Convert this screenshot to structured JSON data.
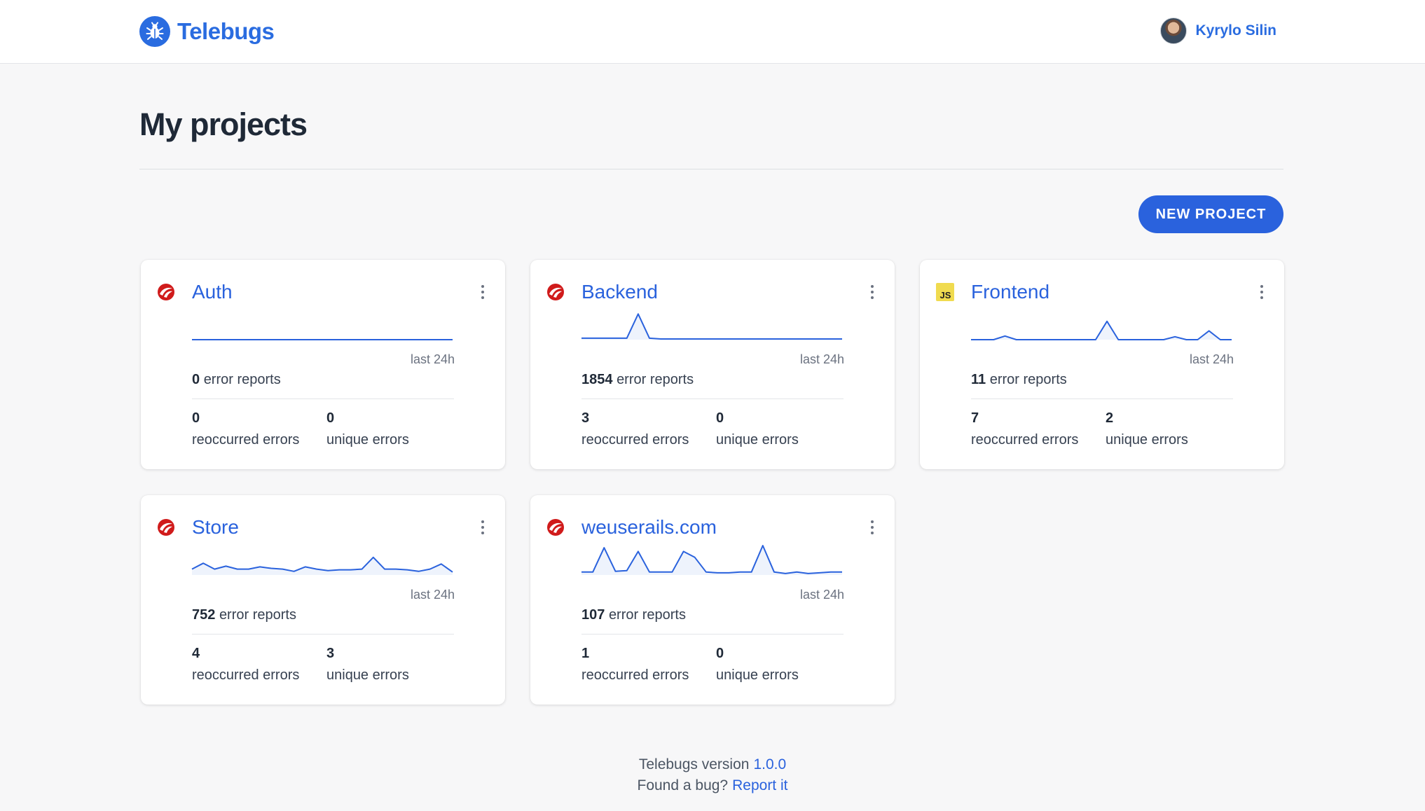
{
  "header": {
    "brand": "Telebugs",
    "user_name": "Kyrylo Silin"
  },
  "page": {
    "title": "My projects",
    "new_project_label": "NEW PROJECT"
  },
  "colors": {
    "accent": "#2a62dd",
    "ruby": "#d01b1b",
    "javascript": "#f0db4f"
  },
  "projects": [
    {
      "name": "Auth",
      "icon": "ruby-icon",
      "period": "last 24h",
      "error_reports": "0",
      "error_reports_label": "error reports",
      "reoccurred": "0",
      "reoccurred_label": "reoccurred errors",
      "unique": "0",
      "unique_label": "unique errors",
      "sparkline": [
        0,
        0,
        0,
        0,
        0,
        0,
        0,
        0,
        0,
        0,
        0,
        0,
        0,
        0,
        0,
        0,
        0,
        0,
        0,
        0,
        0,
        0,
        0,
        0
      ]
    },
    {
      "name": "Backend",
      "icon": "ruby-icon",
      "period": "last 24h",
      "error_reports": "1854",
      "error_reports_label": "error reports",
      "reoccurred": "3",
      "reoccurred_label": "reoccurred errors",
      "unique": "0",
      "unique_label": "unique errors",
      "sparkline": [
        2,
        2,
        2,
        2,
        2,
        35,
        2,
        1,
        1,
        1,
        1,
        1,
        1,
        1,
        1,
        1,
        1,
        1,
        1,
        1,
        1,
        1,
        1,
        1
      ]
    },
    {
      "name": "Frontend",
      "icon": "js-icon",
      "period": "last 24h",
      "error_reports": "11",
      "error_reports_label": "error reports",
      "reoccurred": "7",
      "reoccurred_label": "reoccurred errors",
      "unique": "2",
      "unique_label": "unique errors",
      "sparkline": [
        0,
        0,
        0,
        5,
        0,
        0,
        0,
        0,
        0,
        0,
        0,
        0,
        25,
        0,
        0,
        0,
        0,
        0,
        4,
        0,
        0,
        12,
        0,
        0
      ]
    },
    {
      "name": "Store",
      "icon": "ruby-icon",
      "period": "last 24h",
      "error_reports": "752",
      "error_reports_label": "error reports",
      "reoccurred": "4",
      "reoccurred_label": "reoccurred errors",
      "unique": "3",
      "unique_label": "unique errors",
      "sparkline": [
        8,
        16,
        8,
        12,
        8,
        8,
        11,
        9,
        8,
        5,
        11,
        8,
        6,
        7,
        7,
        8,
        24,
        8,
        8,
        7,
        5,
        8,
        15,
        4
      ]
    },
    {
      "name": "weuserails.com",
      "icon": "ruby-icon",
      "period": "last 24h",
      "error_reports": "107",
      "error_reports_label": "error reports",
      "reoccurred": "1",
      "reoccurred_label": "reoccurred errors",
      "unique": "0",
      "unique_label": "unique errors",
      "sparkline": [
        4,
        4,
        37,
        5,
        6,
        32,
        4,
        4,
        4,
        32,
        24,
        4,
        3,
        3,
        4,
        4,
        40,
        4,
        2,
        4,
        2,
        3,
        4,
        4
      ]
    }
  ],
  "footer": {
    "version_label": "Telebugs version",
    "version": "1.0.0",
    "bug_label": "Found a bug?",
    "report_link": "Report it"
  }
}
